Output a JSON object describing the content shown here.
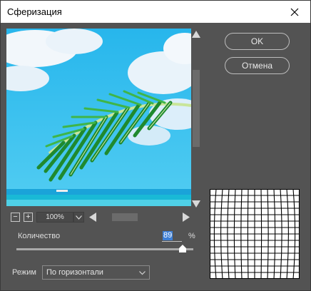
{
  "window": {
    "title": "Сферизация"
  },
  "buttons": {
    "ok_label": "OK",
    "cancel_label": "Отмена"
  },
  "preview": {
    "zoom": "100%"
  },
  "amount": {
    "label": "Количество",
    "value": "89",
    "unit": "%",
    "slider_fraction": 0.89
  },
  "mode": {
    "label": "Режим",
    "selected": "По горизонтали"
  },
  "icons": {
    "close": "close-icon",
    "zoom_out": "zoom-out-icon",
    "zoom_in": "zoom-in-icon",
    "zoom_dropdown": "chevron-down-icon",
    "scroll_up": "arrow-up-icon",
    "scroll_down": "arrow-down-icon",
    "scroll_left": "arrow-left-icon",
    "scroll_right": "arrow-right-icon"
  },
  "colors": {
    "dialog_bg": "#535353",
    "selection": "#3d7fd6",
    "sky": "#2ec0ee",
    "sea": "#1aa3d9",
    "palm": "#2e9a3a"
  },
  "zoom_buttons": {
    "minus": "−",
    "plus": "+"
  }
}
